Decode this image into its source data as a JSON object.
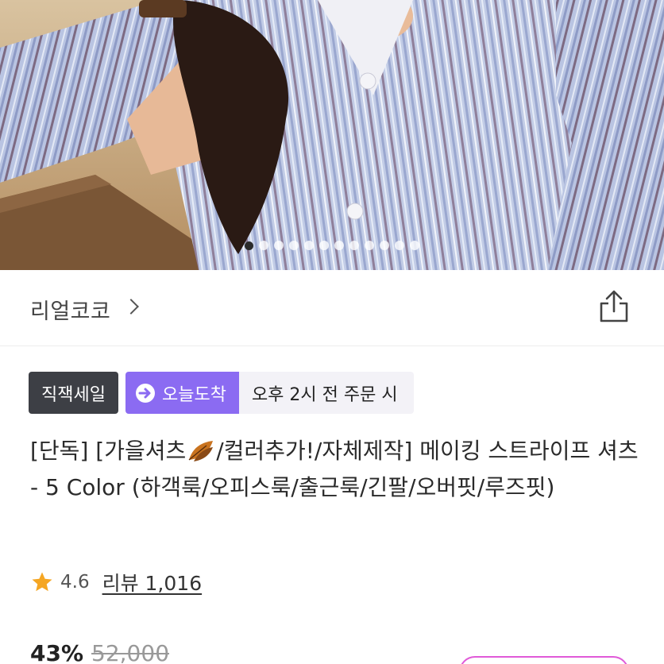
{
  "hero": {
    "image_desc_icon": "product-photo",
    "dot_count": 12,
    "active_dot": 0
  },
  "store": {
    "name": "리얼코코"
  },
  "badges": {
    "sale": "직잭세일",
    "delivery": "오늘도착",
    "delivery_note": "오후 2시 전 주문 시"
  },
  "product": {
    "title_part1": "[단독] [가을셔츠",
    "title_part2": "/컬러추가!/자체제작] 메이킹 스트라이프 셔츠 - 5 Color (하객룩/오피스룩/출근룩/긴팔/오버핏/루즈핏)"
  },
  "rating": {
    "score": "4.6",
    "reviews": "리뷰 1,016"
  },
  "price": {
    "discount": "43%",
    "original": "52,000"
  },
  "colors": {
    "sale_badge": "#3d3f45",
    "delivery_badge": "#8b6bf2",
    "delivery_note_bg": "#f3f2f7",
    "star": "#f5a623",
    "pill_border": "#e05ad8"
  }
}
